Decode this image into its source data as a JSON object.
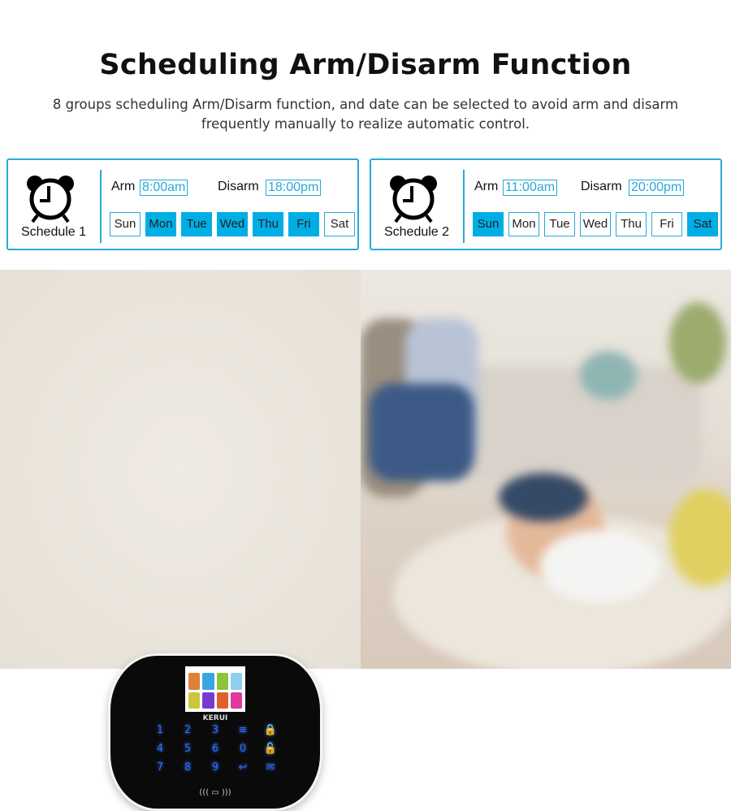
{
  "title": "Scheduling Arm/Disarm Function",
  "subtitle": "8 groups scheduling Arm/Disarm function, and date can be selected to avoid arm and disarm frequently manually to realize automatic control.",
  "accent_color": "#2aa8d8",
  "selected_day_color": "#00aee6",
  "schedules": [
    {
      "name": "Schedule 1",
      "arm_label": "Arm",
      "arm_time": "8:00am",
      "disarm_label": "Disarm",
      "disarm_time": "18:00pm",
      "days": [
        {
          "label": "Sun",
          "on": false
        },
        {
          "label": "Mon",
          "on": true
        },
        {
          "label": "Tue",
          "on": true
        },
        {
          "label": "Wed",
          "on": true
        },
        {
          "label": "Thu",
          "on": true
        },
        {
          "label": "Fri",
          "on": true
        },
        {
          "label": "Sat",
          "on": false
        }
      ]
    },
    {
      "name": "Schedule 2",
      "arm_label": "Arm",
      "arm_time": "11:00am",
      "disarm_label": "Disarm",
      "disarm_time": "20:00pm",
      "days": [
        {
          "label": "Sun",
          "on": true
        },
        {
          "label": "Mon",
          "on": false
        },
        {
          "label": "Tue",
          "on": false
        },
        {
          "label": "Wed",
          "on": false
        },
        {
          "label": "Thu",
          "on": false
        },
        {
          "label": "Fri",
          "on": false
        },
        {
          "label": "Sat",
          "on": true
        }
      ]
    }
  ],
  "device": {
    "brand": "KERUI",
    "keys": [
      "1",
      "2",
      "3",
      "≡",
      "🔒",
      "4",
      "5",
      "6",
      "0",
      "🔓",
      "7",
      "8",
      "9",
      "↩",
      "✉"
    ],
    "rfid": "((( ▭ )))"
  }
}
